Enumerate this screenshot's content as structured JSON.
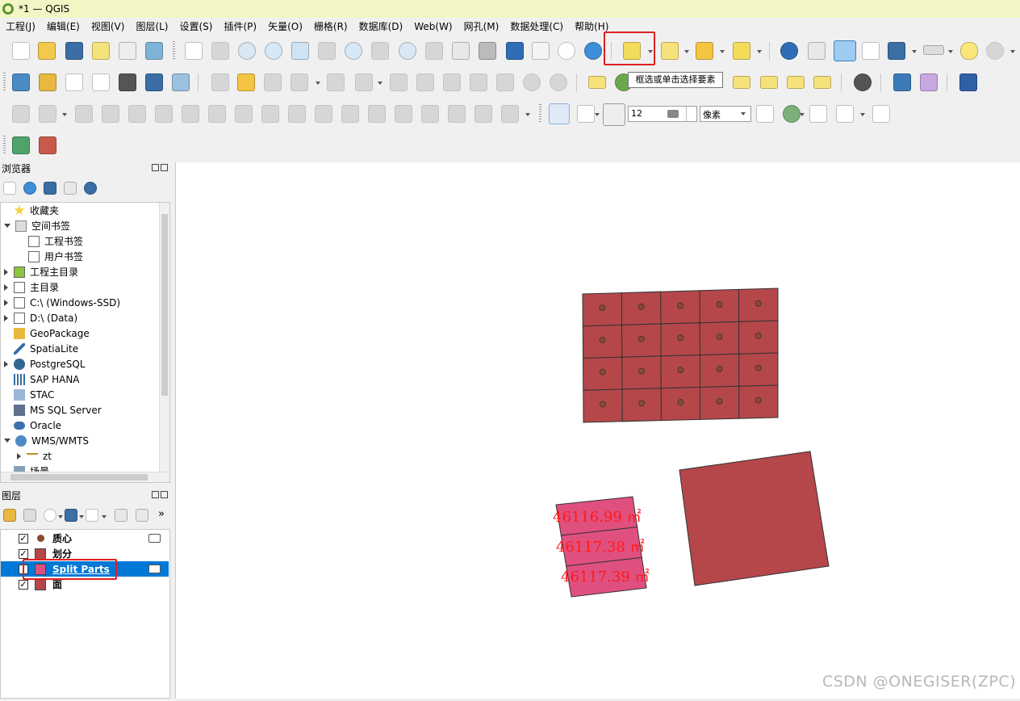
{
  "window": {
    "title": "*1 — QGIS"
  },
  "menu": [
    "工程(J)",
    "编辑(E)",
    "视图(V)",
    "图层(L)",
    "设置(S)",
    "插件(P)",
    "矢量(O)",
    "栅格(R)",
    "数据库(D)",
    "Web(W)",
    "网孔(M)",
    "数据处理(C)",
    "帮助(H)"
  ],
  "tooltip": "框选或单击选择要素",
  "snapping": {
    "tolerance": "12",
    "units": "像素"
  },
  "browser": {
    "title": "浏览器",
    "items": [
      "收藏夹",
      "空间书签",
      "工程书签",
      "用户书签",
      "工程主目录",
      "主目录",
      "C:\\ (Windows-SSD)",
      "D:\\ (Data)",
      "GeoPackage",
      "SpatiaLite",
      "PostgreSQL",
      "SAP HANA",
      "STAC",
      "MS SQL Server",
      "Oracle",
      "WMS/WMTS",
      "zt",
      "场景"
    ]
  },
  "layers": {
    "title": "图层",
    "items": [
      {
        "name": "质心",
        "color": "#8b4a2c"
      },
      {
        "name": "划分",
        "color": "#b5474a"
      },
      {
        "name": "Split Parts",
        "color": "#e0507f"
      },
      {
        "name": "面",
        "color": "#b5474a"
      }
    ]
  },
  "map": {
    "fill_color": "#b5474a",
    "split_color": "#e0507f",
    "centroid_color": "#8b4a2c",
    "area_labels": [
      "46116.99 ㎡",
      "46117.38 ㎡",
      "46117.39 ㎡"
    ]
  },
  "watermark": "CSDN @ONEGISER(ZPC)"
}
